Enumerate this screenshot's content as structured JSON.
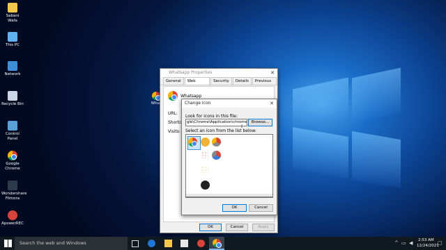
{
  "desktop": {
    "icons": [
      {
        "label": "Sabani Wafa"
      },
      {
        "label": "This PC"
      },
      {
        "label": "Network"
      },
      {
        "label": "Recycle Bin"
      },
      {
        "label": "Control Panel"
      },
      {
        "label": "Google Chrome"
      },
      {
        "label": "Wondershare Filmora"
      },
      {
        "label": "ApowerREC"
      }
    ],
    "partial_icon_label": "What"
  },
  "properties_dialog": {
    "title": "Whatsapp Properties",
    "tabs": [
      "General",
      "Web Document",
      "Security",
      "Details",
      "Previous Versions"
    ],
    "app_name": "Whatsapp",
    "url_label": "URL:",
    "shortcut_label": "Shortcut k",
    "visits_label": "Visits:",
    "ok_label": "OK",
    "cancel_label": "Cancel",
    "apply_label": "Apply"
  },
  "change_icon_dialog": {
    "title": "Change Icon",
    "look_label": "Look for icons in this file:",
    "path_value": "gle\\Chrome\\Application\\chrome.exe",
    "browse_label": "Browse...",
    "select_label": "Select an icon from the list below:",
    "ok_label": "OK",
    "cancel_label": "Cancel"
  },
  "taskbar": {
    "search_placeholder": "Search the web and Windows",
    "time": "2:53 AM",
    "date": "12/24/2021"
  }
}
